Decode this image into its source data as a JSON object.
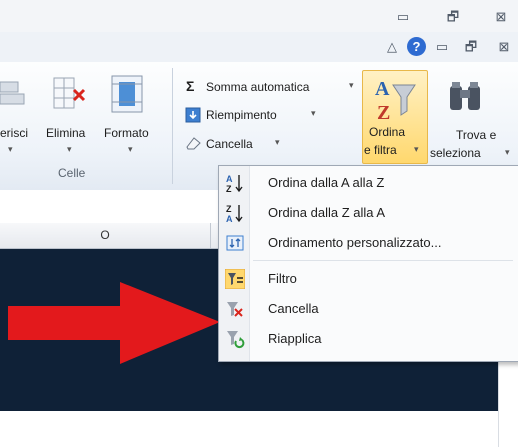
{
  "window": {
    "minimize_glyph": "▭",
    "restore_glyph": "🗗",
    "close_glyph": "⊠",
    "sub_minimize_glyph": "▭",
    "sub_restore_glyph": "🗗",
    "sub_close_glyph": "⊠",
    "ribbon_toggle_glyph": "△",
    "help_glyph": "?"
  },
  "ribbon": {
    "cells_group": {
      "insert_label": "erisci",
      "delete_label": "Elimina",
      "format_label": "Formato",
      "group_label": "Celle"
    },
    "editing_group": {
      "autosum_label": "Somma automatica",
      "fill_label": "Riempimento",
      "clear_label": "Cancella",
      "sort_label_1": "Ordina",
      "sort_label_2": "e filtra",
      "find_label_1": "Trova e",
      "find_label_2": "seleziona",
      "sigma_glyph": "Σ"
    }
  },
  "grid": {
    "column_label": "O"
  },
  "menu": {
    "items": [
      {
        "label": "Ordina dalla A alla Z",
        "icon": "sort-az-icon"
      },
      {
        "label": "Ordina dalla Z alla A",
        "icon": "sort-za-icon"
      },
      {
        "label": "Ordinamento personalizzato...",
        "icon": "custom-sort-icon"
      },
      {
        "label": "Filtro",
        "icon": "filter-icon"
      },
      {
        "label": "Cancella",
        "icon": "clear-filter-icon"
      },
      {
        "label": "Riapplica",
        "icon": "reapply-icon"
      }
    ]
  },
  "colors": {
    "dark_area": "#0f2137",
    "arrow": "#e3191c",
    "highlight": "#ffd86e",
    "help_blue": "#2e6bd1"
  }
}
